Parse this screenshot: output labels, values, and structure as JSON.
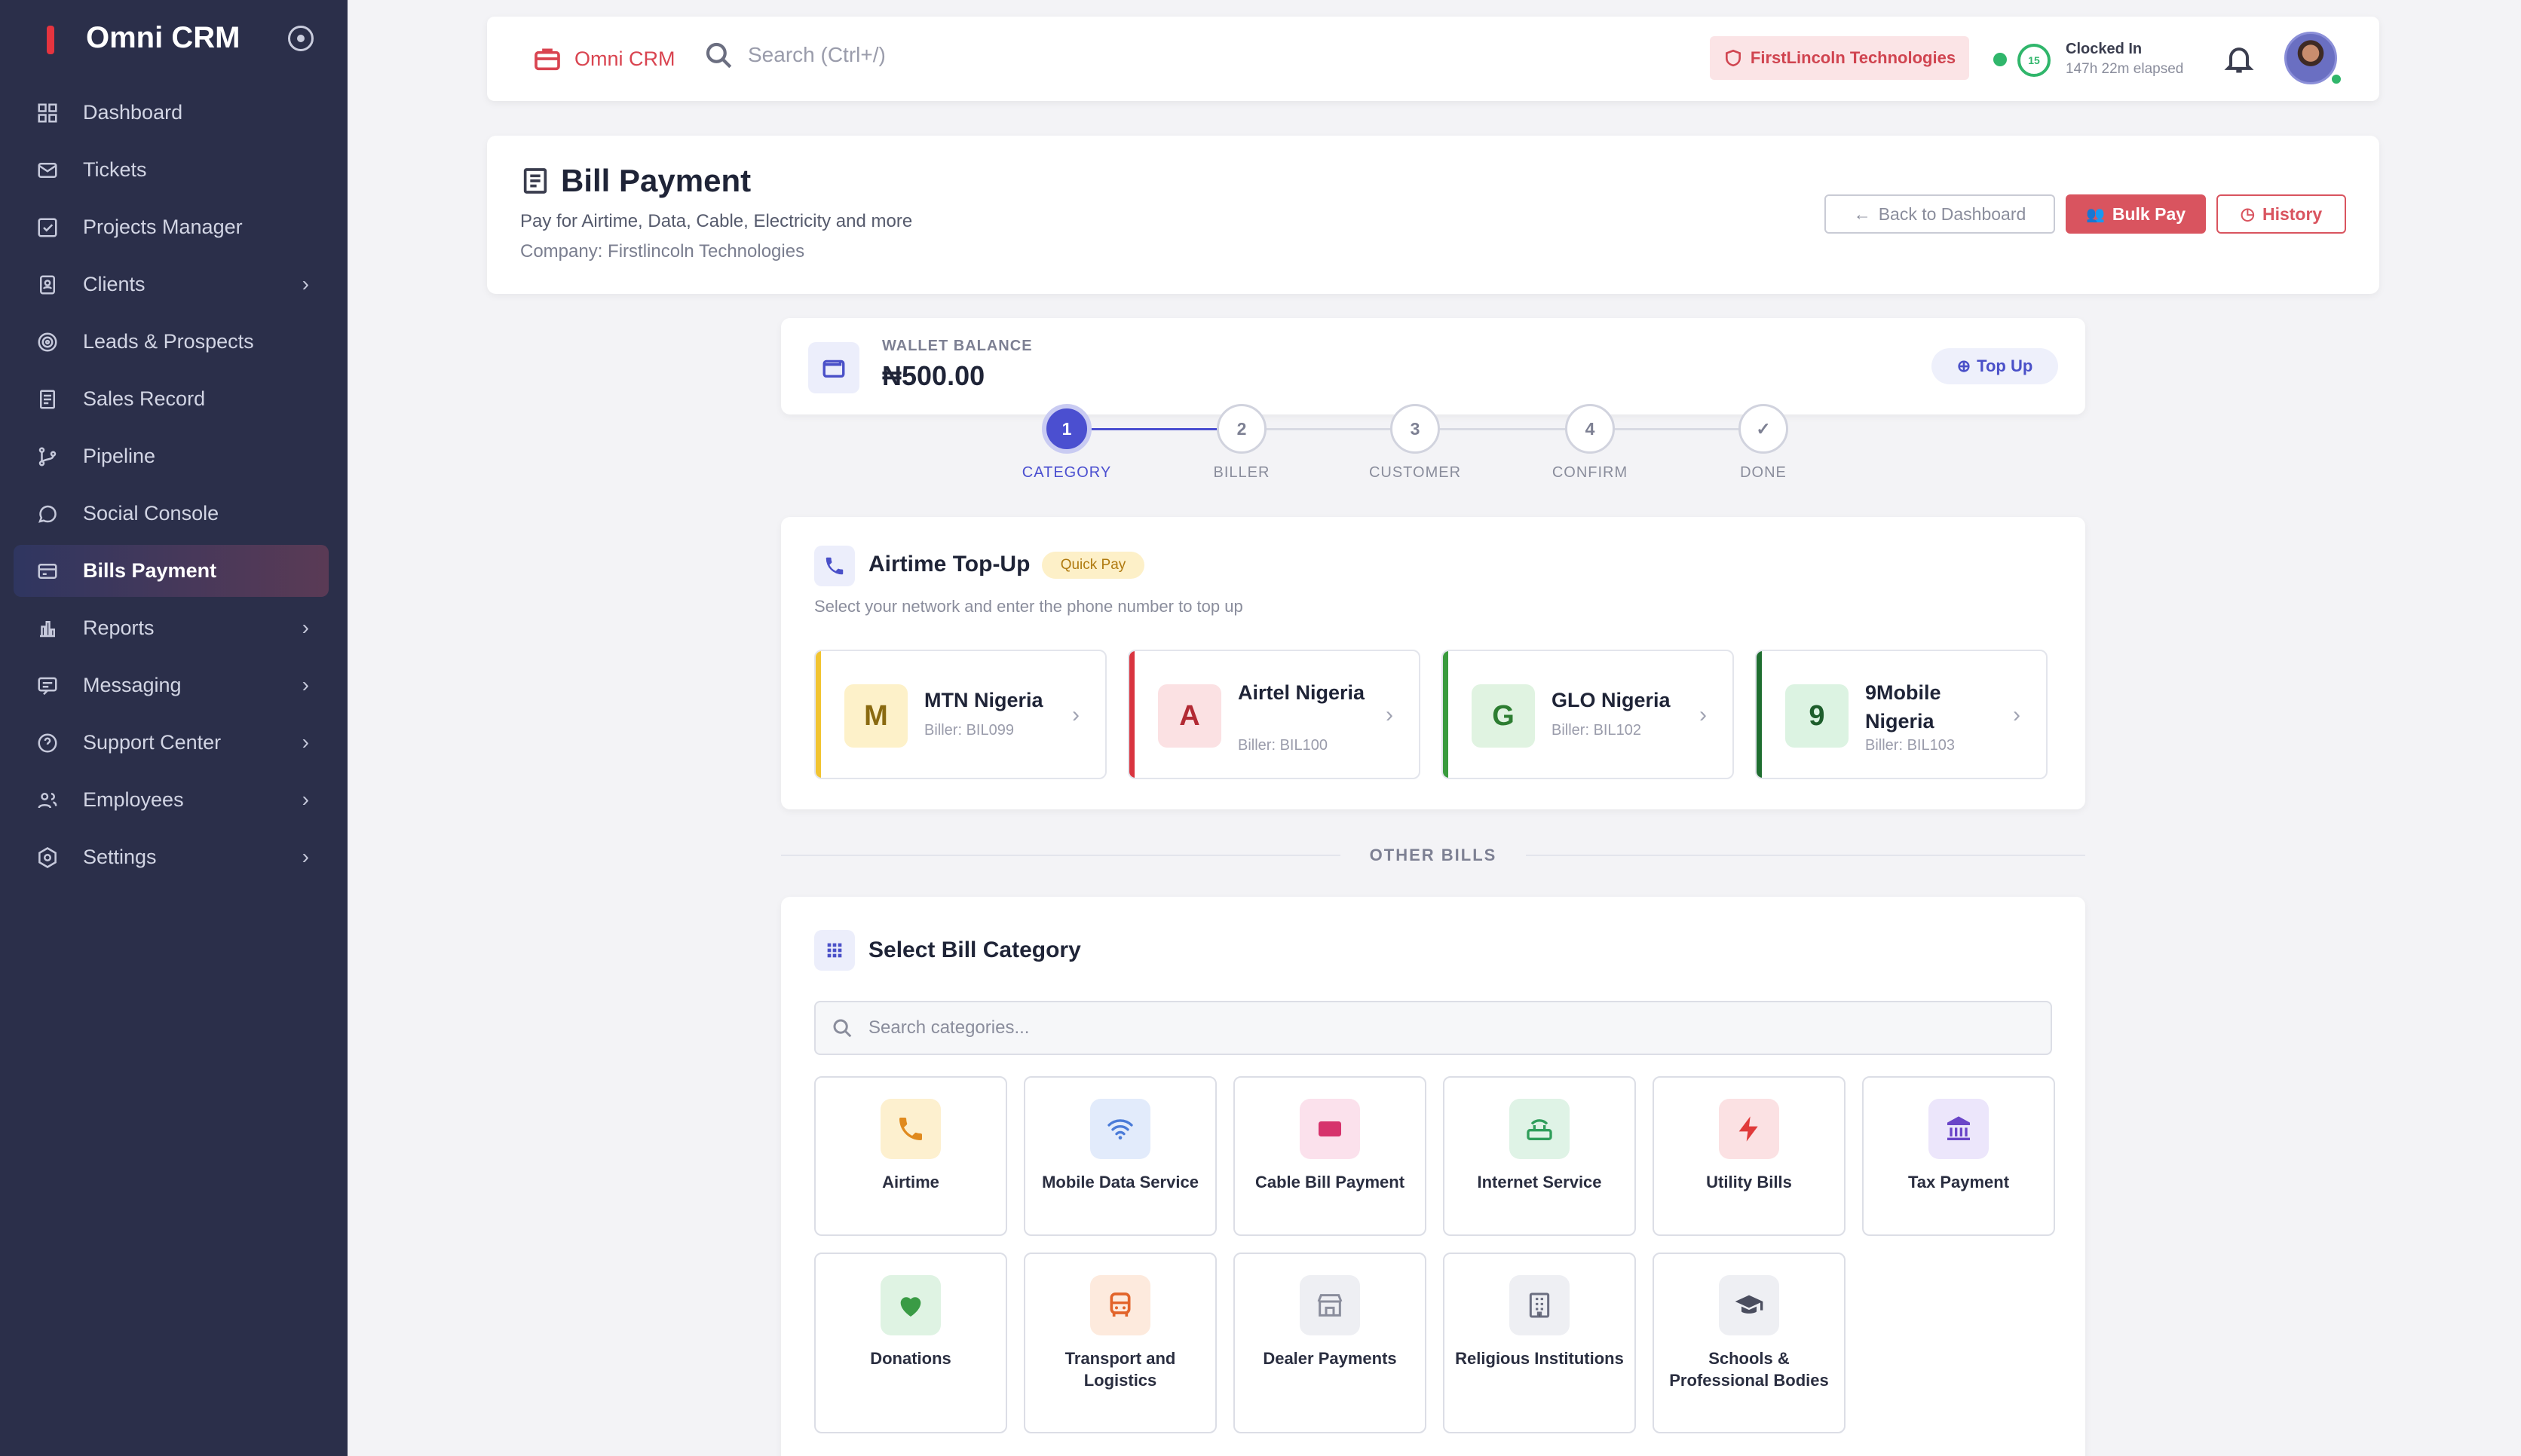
{
  "sidebar": {
    "brand": "Omni CRM",
    "items": [
      {
        "label": "Dashboard",
        "icon": "dashboard-icon",
        "chevron": false
      },
      {
        "label": "Tickets",
        "icon": "mail-icon",
        "chevron": false
      },
      {
        "label": "Projects Manager",
        "icon": "checkbox-icon",
        "chevron": false
      },
      {
        "label": "Clients",
        "icon": "contact-icon",
        "chevron": true
      },
      {
        "label": "Leads & Prospects",
        "icon": "target-icon",
        "chevron": false
      },
      {
        "label": "Sales Record",
        "icon": "receipt-icon",
        "chevron": false
      },
      {
        "label": "Pipeline",
        "icon": "git-branch-icon",
        "chevron": false
      },
      {
        "label": "Social Console",
        "icon": "whatsapp-icon",
        "chevron": false
      },
      {
        "label": "Bills Payment",
        "icon": "credit-card-icon",
        "chevron": false,
        "active": true
      },
      {
        "label": "Reports",
        "icon": "bar-chart-icon",
        "chevron": true
      },
      {
        "label": "Messaging",
        "icon": "message-icon",
        "chevron": true
      },
      {
        "label": "Support Center",
        "icon": "help-circle-icon",
        "chevron": true
      },
      {
        "label": "Employees",
        "icon": "users-icon",
        "chevron": true
      },
      {
        "label": "Settings",
        "icon": "settings-icon",
        "chevron": true
      }
    ]
  },
  "topbar": {
    "brand": "Omni CRM",
    "search_placeholder": "Search (Ctrl+/)",
    "company": "FirstLincoln Technologies",
    "clock_ring": "15",
    "clock_status": "Clocked In",
    "clock_elapsed": "147h 22m elapsed"
  },
  "header": {
    "title": "Bill Payment",
    "subtitle": "Pay for Airtime, Data, Cable, Electricity and more",
    "company": "Company: Firstlincoln Technologies",
    "back_label": "Back to Dashboard",
    "bulk_label": "Bulk Pay",
    "history_label": "History"
  },
  "wallet": {
    "label": "WALLET BALANCE",
    "amount": "₦500.00",
    "topup_label": "Top Up"
  },
  "steps": [
    {
      "num": "1",
      "label": "CATEGORY",
      "active": true
    },
    {
      "num": "2",
      "label": "BILLER"
    },
    {
      "num": "3",
      "label": "CUSTOMER"
    },
    {
      "num": "4",
      "label": "CONFIRM"
    },
    {
      "num": "✓",
      "label": "DONE"
    }
  ],
  "airtime": {
    "title": "Airtime Top-Up",
    "badge": "Quick Pay",
    "subtitle": "Select your network and enter the phone number to top up",
    "networks": [
      {
        "letter": "M",
        "name": "MTN Nigeria",
        "biller": "Biller: BIL099",
        "bar": "#f2c431",
        "bg": "#fdf1c9",
        "fg": "#8a6a10"
      },
      {
        "letter": "A",
        "name": "Airtel Nigeria",
        "biller": "Biller: BIL100",
        "bar": "#d9343f",
        "bg": "#fbe1e3",
        "fg": "#b22a34"
      },
      {
        "letter": "G",
        "name": "GLO Nigeria",
        "biller": "Biller: BIL102",
        "bar": "#3a9b3e",
        "bg": "#e0f3e1",
        "fg": "#2d7d31"
      },
      {
        "letter": "9",
        "name": "9Mobile Nigeria",
        "biller": "Biller: BIL103",
        "bar": "#1f6e30",
        "bg": "#dcf3e2",
        "fg": "#1d5d2b"
      }
    ]
  },
  "other_bills_label": "OTHER BILLS",
  "categories": {
    "title": "Select Bill Category",
    "search_placeholder": "Search categories...",
    "items": [
      {
        "label": "Airtime",
        "icon": "phone-icon",
        "bg": "#fdf0cf",
        "color": "#e08a1e"
      },
      {
        "label": "Mobile Data Service",
        "icon": "wifi-icon",
        "bg": "#e2ebfb",
        "color": "#4a7bd8"
      },
      {
        "label": "Cable Bill Payment",
        "icon": "tv-icon",
        "bg": "#fbe1ec",
        "color": "#d6336c"
      },
      {
        "label": "Internet Service",
        "icon": "router-icon",
        "bg": "#dff3e6",
        "color": "#2f9e5a"
      },
      {
        "label": "Utility Bills",
        "icon": "lightning-icon",
        "bg": "#fbe1e3",
        "color": "#e03a3a"
      },
      {
        "label": "Tax Payment",
        "icon": "bank-icon",
        "bg": "#ece6fb",
        "color": "#6a45c8"
      },
      {
        "label": "Donations",
        "icon": "heart-icon",
        "bg": "#dff3e3",
        "color": "#3a9b45"
      },
      {
        "label": "Transport and Logistics",
        "icon": "bus-icon",
        "bg": "#fdeadd",
        "color": "#e2642a"
      },
      {
        "label": "Dealer Payments",
        "icon": "store-icon",
        "bg": "#eeeff3",
        "color": "#8a8d9c"
      },
      {
        "label": "Religious Institutions",
        "icon": "building-icon",
        "bg": "#eeeff3",
        "color": "#6b6e80"
      },
      {
        "label": "Schools & Professional Bodies",
        "icon": "graduation-cap-icon",
        "bg": "#eeeff3",
        "color": "#4a4d5e"
      }
    ]
  }
}
